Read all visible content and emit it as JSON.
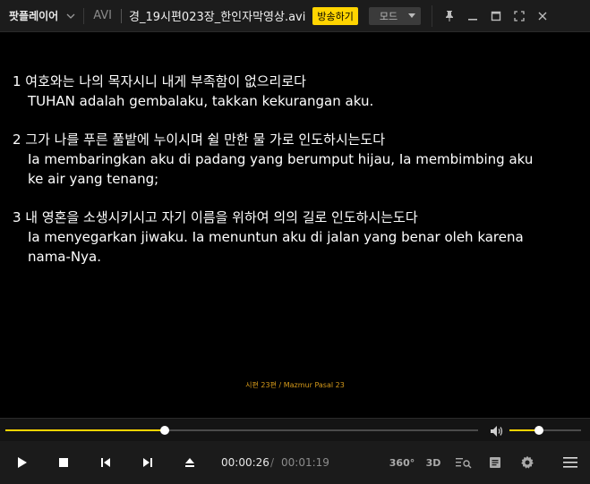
{
  "app": {
    "name": "팟플레이어",
    "format": "AVI",
    "file_title": "경_19시편023장_한인자막영상.avi",
    "broadcast_label": "방송하기",
    "mode_label": "모드"
  },
  "video": {
    "verses": [
      {
        "kr": "1 여호와는 나의 목자시니 내게 부족함이 없으리로다",
        "id": [
          "TUHAN adalah gembalaku, takkan kekurangan aku."
        ]
      },
      {
        "kr": "2 그가 나를 푸른 풀밭에 누이시며 쉴 만한 물 가로 인도하시는도다",
        "id": [
          "Ia membaringkan aku di padang yang berumput hijau, Ia membimbing aku",
          "ke air yang tenang;"
        ]
      },
      {
        "kr": "3 내 영혼을 소생시키시고 자기 이름을 위하여 의의 길로 인도하시는도다",
        "id": [
          "Ia menyegarkan jiwaku. Ia menuntun aku di jalan yang benar oleh karena",
          "nama-Nya."
        ]
      }
    ],
    "caption": "시편 23편 / Mazmur Pasal 23"
  },
  "playback": {
    "progress_fraction": 0.337,
    "volume_fraction": 0.41,
    "current_time": "00:00:26",
    "separator": "/",
    "duration": "00:01:19",
    "accent_color": "#ffd400"
  },
  "icons": {
    "play": "play-icon",
    "stop": "stop-icon",
    "prev": "skip-previous-icon",
    "next": "skip-next-icon",
    "eject": "eject-icon",
    "vr": "360-icon",
    "three_d": "3d-icon",
    "playlist_search": "playlist-search-icon",
    "chapter": "chapter-icon",
    "settings": "gear-icon",
    "menu": "hamburger-icon"
  },
  "labels": {
    "vr": "360°",
    "three_d": "3D"
  }
}
